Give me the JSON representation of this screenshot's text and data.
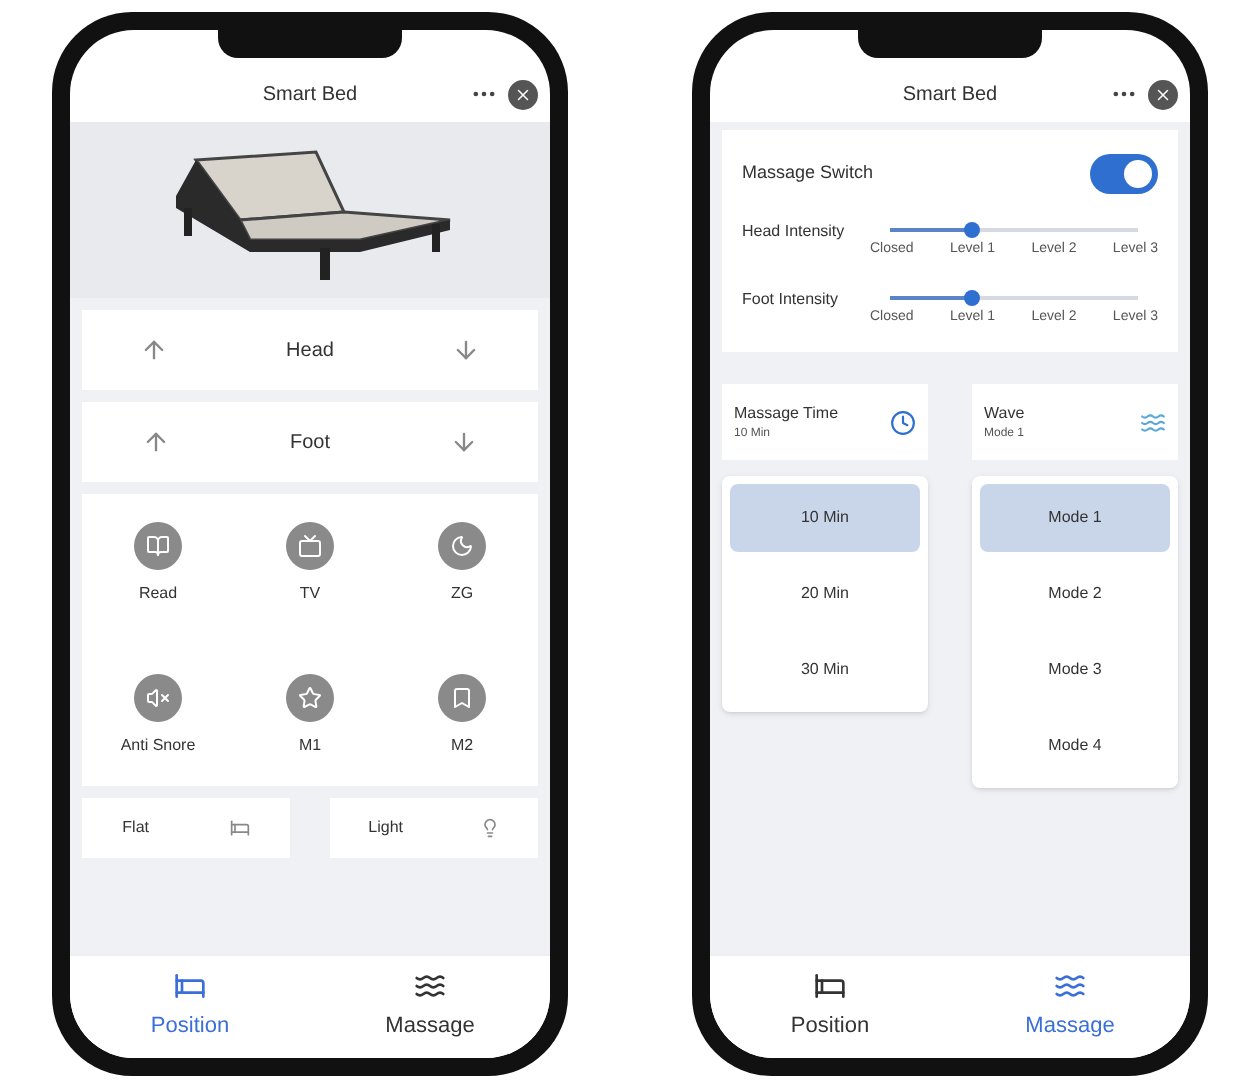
{
  "phones": [
    {
      "kind": "position",
      "title": "Smart Bed",
      "adjust_rows": [
        {
          "label": "Head"
        },
        {
          "label": "Foot"
        }
      ],
      "presets": [
        {
          "label": "Read"
        },
        {
          "label": "TV"
        },
        {
          "label": "ZG"
        },
        {
          "label": "Anti Snore"
        },
        {
          "label": "M1"
        },
        {
          "label": "M2"
        }
      ],
      "bottom_cards": [
        {
          "label": "Flat"
        },
        {
          "label": "Light"
        }
      ],
      "tabs": [
        {
          "label": "Position",
          "selected": true
        },
        {
          "label": "Massage",
          "selected": false
        }
      ]
    },
    {
      "kind": "massage",
      "title": "Smart Bed",
      "switch": {
        "label": "Massage Switch",
        "on": true
      },
      "intensities": [
        {
          "label": "Head Intensity",
          "level": 0.33,
          "ticks": [
            "Closed",
            "Level 1",
            "Level 2",
            "Level 3"
          ]
        },
        {
          "label": "Foot Intensity",
          "level": 0.33,
          "ticks": [
            "Closed",
            "Level 1",
            "Level 2",
            "Level 3"
          ]
        }
      ],
      "time": {
        "label": "Massage Time",
        "value": "10 Min",
        "options": [
          {
            "label": "10 Min",
            "selected": true
          },
          {
            "label": "20 Min",
            "selected": false
          },
          {
            "label": "30 Min",
            "selected": false
          }
        ]
      },
      "wave": {
        "label": "Wave",
        "value": "Mode 1",
        "options": [
          {
            "label": "Mode 1",
            "selected": true
          },
          {
            "label": "Mode 2",
            "selected": false
          },
          {
            "label": "Mode 3",
            "selected": false
          },
          {
            "label": "Mode 4",
            "selected": false
          }
        ]
      },
      "tabs": [
        {
          "label": "Position",
          "selected": false
        },
        {
          "label": "Massage",
          "selected": true
        }
      ]
    }
  ]
}
